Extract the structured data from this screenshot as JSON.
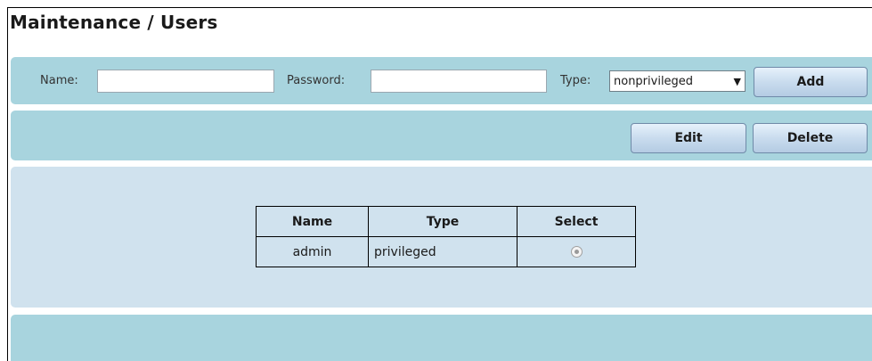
{
  "page": {
    "title": "Maintenance / Users"
  },
  "add_form": {
    "name_label": "Name:",
    "name_value": "",
    "password_label": "Password:",
    "password_value": "",
    "type_label": "Type:",
    "type_selected": "nonprivileged",
    "type_arrow": "▼",
    "add_label": "Add"
  },
  "actions": {
    "edit_label": "Edit",
    "delete_label": "Delete"
  },
  "users_table": {
    "headers": [
      "Name",
      "Type",
      "Select"
    ],
    "rows": [
      {
        "name": "admin",
        "type": "privileged",
        "selected": true
      }
    ]
  },
  "colors": {
    "bar": "#a8d4de",
    "panel": "#d0e2ee",
    "button_border": "#6f8aa8"
  }
}
